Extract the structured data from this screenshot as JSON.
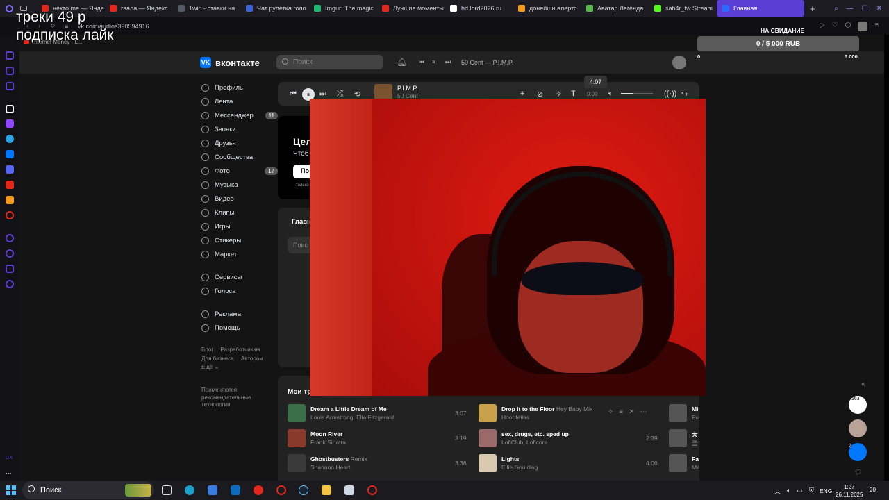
{
  "browser": {
    "tabs": [
      {
        "label": "некто me — Янде",
        "color": "#e5261a"
      },
      {
        "label": "гвала — Яндекс",
        "color": "#e5261a"
      },
      {
        "label": "1win - ставки на",
        "color": "#555b66"
      },
      {
        "label": "Чат рулетка голо",
        "color": "#3b63d6"
      },
      {
        "label": "Imgur: The magic",
        "color": "#1bb76e"
      },
      {
        "label": "Лучшие моменты",
        "color": "#e5261a"
      },
      {
        "label": "hd.lord2026.ru",
        "color": "#ffffff"
      },
      {
        "label": "донейшн алертс",
        "color": "#f29a1a"
      },
      {
        "label": "Аватар Легенда",
        "color": "#58b84a"
      },
      {
        "label": "sah4r_tw Stream",
        "color": "#53fc18"
      },
      {
        "label": "Главная",
        "color": "#2c6bff"
      }
    ],
    "url": "vk.com/audios390594916",
    "pinned_label": "Internet Money - L..."
  },
  "overlay": {
    "line1": "треки 49 р",
    "line2": "подписка лайк"
  },
  "donation": {
    "title": "НА СВИДАНИЕ",
    "progress": "0 / 5 000 RUB",
    "min": "0",
    "max": "5 000",
    "fraction": 0
  },
  "vk": {
    "logo": "вконтакте",
    "search_placeholder": "Поиск",
    "header_track": "50 Cent — P.I.M.P.",
    "nav": [
      {
        "label": "Профиль",
        "icon": "profile-icon"
      },
      {
        "label": "Лента",
        "icon": "feed-icon"
      },
      {
        "label": "Мессенджер",
        "icon": "messenger-icon",
        "badge": "11"
      },
      {
        "label": "Звонки",
        "icon": "calls-icon"
      },
      {
        "label": "Друзья",
        "icon": "friends-icon"
      },
      {
        "label": "Сообщества",
        "icon": "communities-icon"
      },
      {
        "label": "Фото",
        "icon": "photo-icon",
        "badge": "17"
      },
      {
        "label": "Музыка",
        "icon": "music-icon"
      },
      {
        "label": "Видео",
        "icon": "video-icon"
      },
      {
        "label": "Клипы",
        "icon": "clips-icon"
      },
      {
        "label": "Игры",
        "icon": "games-icon"
      },
      {
        "label": "Стикеры",
        "icon": "stickers-icon"
      },
      {
        "label": "Маркет",
        "icon": "market-icon"
      }
    ],
    "nav2": [
      {
        "label": "Сервисы",
        "icon": "services-icon"
      },
      {
        "label": "Голоса",
        "icon": "votes-icon"
      }
    ],
    "nav3": [
      {
        "label": "Реклама",
        "icon": "ads-icon"
      },
      {
        "label": "Помощь",
        "icon": "help-icon"
      }
    ],
    "footer": {
      "blog": "Блог",
      "devs": "Разработчикам",
      "business": "Для бизнеса",
      "authors": "Авторам",
      "more": "Ещё ⌄"
    },
    "rec_note": "Применяются рекомендательные технологии",
    "player": {
      "title": "P.I.M.P.",
      "artist": "50 Cent",
      "tooltip_time": "4:07",
      "time": "0:00",
      "volume": 0.4
    },
    "card1": {
      "title": "Цел",
      "subtitle": "Чтоб",
      "button": "По",
      "small": "только"
    },
    "card2": {
      "title": "Главн",
      "input": "Поис"
    },
    "tracks_title": "Мои тр",
    "tracks_left": [
      {
        "title": "Dream a Little Dream of Me",
        "extra": "",
        "artist": "Louis Armstrong, Ella Fitzgerald",
        "duration": "3:07",
        "color": "#3a6f4a"
      },
      {
        "title": "Moon River",
        "extra": "",
        "artist": "Frank Sinatra",
        "duration": "3:19",
        "color": "#8a3a2a"
      },
      {
        "title": "Ghostbusters",
        "extra": "Remix",
        "artist": "Shannon Heart",
        "duration": "3:36",
        "color": "#3a3a3a"
      }
    ],
    "tracks_right": [
      {
        "title": "Drop it to the Floor",
        "extra": "Hey Baby Mix",
        "artist": "Hoodfellas",
        "duration": "",
        "color": "#c7a24a"
      },
      {
        "title": "sex, drugs, etc. sped up",
        "extra": "",
        "artist": "LofiClub, Loficore",
        "duration": "2:39",
        "color": "#9a6a6a"
      },
      {
        "title": "Lights",
        "extra": "",
        "artist": "Ellie Goulding",
        "duration": "4:06",
        "color": "#d9c9b0"
      }
    ],
    "tracks_far": [
      {
        "title": "Mi",
        "artist": "Fu"
      },
      {
        "title": "大",
        "artist": "盖"
      },
      {
        "title": "Fa",
        "artist": "Ma"
      }
    ]
  },
  "right_panel": {
    "counter": "163",
    "vk_badge": "2"
  },
  "taskbar": {
    "search": "Поиск",
    "lang": "ENG",
    "time": "1:27",
    "date": "26.11.2025",
    "notif": "20"
  }
}
